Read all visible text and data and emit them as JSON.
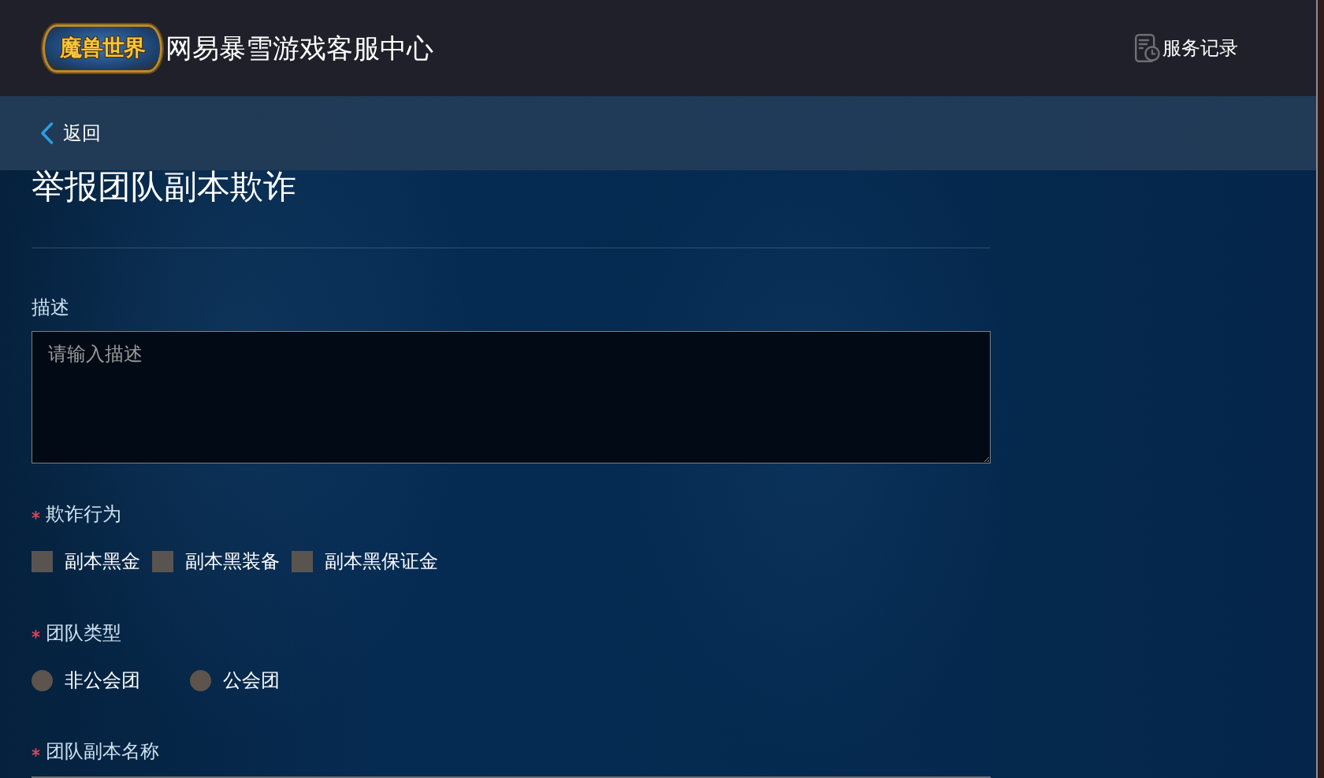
{
  "header": {
    "logo_text": "魔兽世界",
    "title": "网易暴雪游戏客服中心",
    "service_records_link": "服务记录"
  },
  "back_link": "返回",
  "page_title": "举报团队副本欺诈",
  "form": {
    "fields": [
      {
        "kind": "textarea",
        "label": "描述",
        "required": false,
        "placeholder": "请输入描述"
      },
      {
        "kind": "checkboxes",
        "label": "欺诈行为",
        "required": true,
        "options": [
          {
            "label": "副本黑金",
            "checked": false
          },
          {
            "label": "副本黑装备",
            "checked": false
          },
          {
            "label": "副本黑保证金",
            "checked": false
          }
        ]
      },
      {
        "kind": "radios",
        "label": "团队类型",
        "required": true,
        "options": [
          {
            "label": "非公会团",
            "selected": false
          },
          {
            "label": "公会团",
            "selected": false
          }
        ]
      },
      {
        "kind": "text",
        "label": "团队副本名称",
        "required": true
      }
    ]
  }
}
